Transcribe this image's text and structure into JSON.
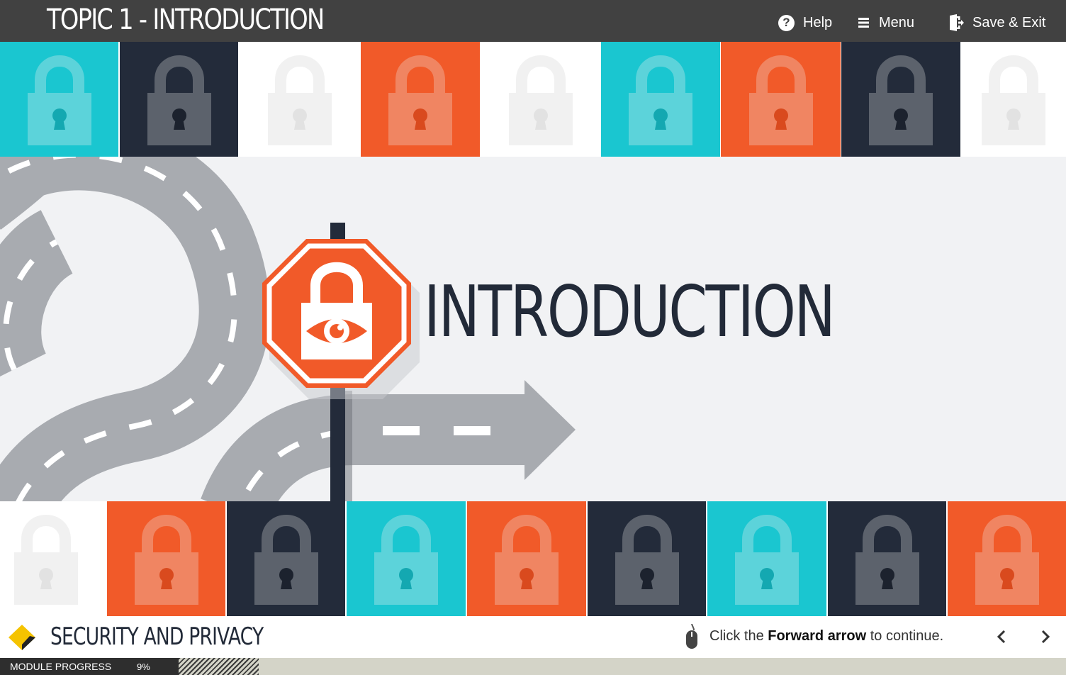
{
  "header": {
    "topic_title": "TOPIC 1 - INTRODUCTION",
    "help_label": "Help",
    "menu_label": "Menu",
    "save_exit_label": "Save & Exit"
  },
  "slide": {
    "heading": "INTRODUCTION"
  },
  "footer": {
    "course_title": "SECURITY AND PRIVACY",
    "instruction_prefix": "Click the ",
    "instruction_bold": "Forward arrow",
    "instruction_suffix": " to continue."
  },
  "progress": {
    "label": "MODULE PROGRESS",
    "percent_text": "9%",
    "value": 0.09
  },
  "colors": {
    "teal": "#1ac6d0",
    "navy": "#232b3a",
    "orange": "#f15a29",
    "white": "#ffffff",
    "road": "#a8abb0"
  },
  "lock_rows": {
    "top": [
      "teal",
      "navy",
      "white",
      "orange",
      "white",
      "teal",
      "orange",
      "navy",
      "white"
    ],
    "bottom": [
      "white",
      "orange",
      "navy",
      "teal",
      "orange",
      "navy",
      "teal",
      "navy",
      "orange"
    ]
  },
  "icons": {
    "help": "help-circle-icon",
    "menu": "hamburger-menu-icon",
    "save_exit": "exit-door-icon",
    "logo": "diamond-logo-icon",
    "mouse": "mouse-icon",
    "back": "chevron-left-icon",
    "forward": "chevron-right-icon",
    "sign": "padlock-eye-stop-sign-icon"
  }
}
